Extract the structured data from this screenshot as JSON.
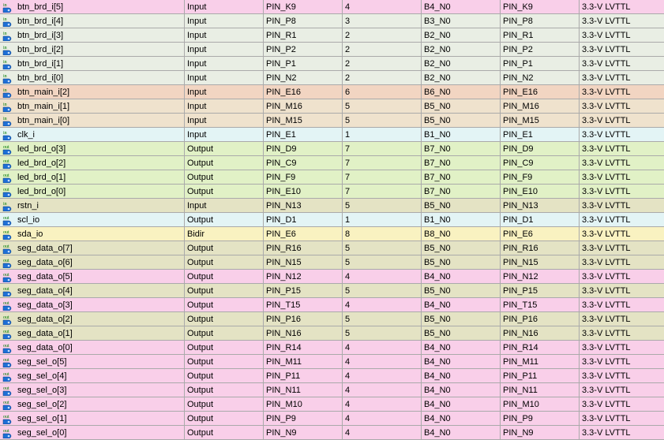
{
  "rows": [
    {
      "dir": "in",
      "bg": "pink",
      "name": "btn_brd_i[5]",
      "direction": "Input",
      "pin": "PIN_K9",
      "bank": "4",
      "vref": "B4_N0",
      "fit": "PIN_K9",
      "std": "3.3-V LVTTL"
    },
    {
      "dir": "in",
      "bg": "grey",
      "name": "btn_brd_i[4]",
      "direction": "Input",
      "pin": "PIN_P8",
      "bank": "3",
      "vref": "B3_N0",
      "fit": "PIN_P8",
      "std": "3.3-V LVTTL"
    },
    {
      "dir": "in",
      "bg": "grey",
      "name": "btn_brd_i[3]",
      "direction": "Input",
      "pin": "PIN_R1",
      "bank": "2",
      "vref": "B2_N0",
      "fit": "PIN_R1",
      "std": "3.3-V LVTTL"
    },
    {
      "dir": "in",
      "bg": "grey",
      "name": "btn_brd_i[2]",
      "direction": "Input",
      "pin": "PIN_P2",
      "bank": "2",
      "vref": "B2_N0",
      "fit": "PIN_P2",
      "std": "3.3-V LVTTL"
    },
    {
      "dir": "in",
      "bg": "grey",
      "name": "btn_brd_i[1]",
      "direction": "Input",
      "pin": "PIN_P1",
      "bank": "2",
      "vref": "B2_N0",
      "fit": "PIN_P1",
      "std": "3.3-V LVTTL"
    },
    {
      "dir": "in",
      "bg": "grey",
      "name": "btn_brd_i[0]",
      "direction": "Input",
      "pin": "PIN_N2",
      "bank": "2",
      "vref": "B2_N0",
      "fit": "PIN_N2",
      "std": "3.3-V LVTTL"
    },
    {
      "dir": "in",
      "bg": "peach",
      "name": "btn_main_i[2]",
      "direction": "Input",
      "pin": "PIN_E16",
      "bank": "6",
      "vref": "B6_N0",
      "fit": "PIN_E16",
      "std": "3.3-V LVTTL"
    },
    {
      "dir": "in",
      "bg": "tan",
      "name": "btn_main_i[1]",
      "direction": "Input",
      "pin": "PIN_M16",
      "bank": "5",
      "vref": "B5_N0",
      "fit": "PIN_M16",
      "std": "3.3-V LVTTL"
    },
    {
      "dir": "in",
      "bg": "tan",
      "name": "btn_main_i[0]",
      "direction": "Input",
      "pin": "PIN_M15",
      "bank": "5",
      "vref": "B5_N0",
      "fit": "PIN_M15",
      "std": "3.3-V LVTTL"
    },
    {
      "dir": "in",
      "bg": "cyan",
      "name": "clk_i",
      "direction": "Input",
      "pin": "PIN_E1",
      "bank": "1",
      "vref": "B1_N0",
      "fit": "PIN_E1",
      "std": "3.3-V LVTTL"
    },
    {
      "dir": "out",
      "bg": "green",
      "name": "led_brd_o[3]",
      "direction": "Output",
      "pin": "PIN_D9",
      "bank": "7",
      "vref": "B7_N0",
      "fit": "PIN_D9",
      "std": "3.3-V LVTTL"
    },
    {
      "dir": "out",
      "bg": "green",
      "name": "led_brd_o[2]",
      "direction": "Output",
      "pin": "PIN_C9",
      "bank": "7",
      "vref": "B7_N0",
      "fit": "PIN_C9",
      "std": "3.3-V LVTTL"
    },
    {
      "dir": "out",
      "bg": "green",
      "name": "led_brd_o[1]",
      "direction": "Output",
      "pin": "PIN_F9",
      "bank": "7",
      "vref": "B7_N0",
      "fit": "PIN_F9",
      "std": "3.3-V LVTTL"
    },
    {
      "dir": "out",
      "bg": "green",
      "name": "led_brd_o[0]",
      "direction": "Output",
      "pin": "PIN_E10",
      "bank": "7",
      "vref": "B7_N0",
      "fit": "PIN_E10",
      "std": "3.3-V LVTTL"
    },
    {
      "dir": "in",
      "bg": "olive",
      "name": "rstn_i",
      "direction": "Input",
      "pin": "PIN_N13",
      "bank": "5",
      "vref": "B5_N0",
      "fit": "PIN_N13",
      "std": "3.3-V LVTTL"
    },
    {
      "dir": "out",
      "bg": "cyan",
      "name": "scl_io",
      "direction": "Output",
      "pin": "PIN_D1",
      "bank": "1",
      "vref": "B1_N0",
      "fit": "PIN_D1",
      "std": "3.3-V LVTTL"
    },
    {
      "dir": "out",
      "bg": "yellow",
      "name": "sda_io",
      "direction": "Bidir",
      "pin": "PIN_E6",
      "bank": "8",
      "vref": "B8_N0",
      "fit": "PIN_E6",
      "std": "3.3-V LVTTL"
    },
    {
      "dir": "out",
      "bg": "olive",
      "name": "seg_data_o[7]",
      "direction": "Output",
      "pin": "PIN_R16",
      "bank": "5",
      "vref": "B5_N0",
      "fit": "PIN_R16",
      "std": "3.3-V LVTTL"
    },
    {
      "dir": "out",
      "bg": "olive",
      "name": "seg_data_o[6]",
      "direction": "Output",
      "pin": "PIN_N15",
      "bank": "5",
      "vref": "B5_N0",
      "fit": "PIN_N15",
      "std": "3.3-V LVTTL"
    },
    {
      "dir": "out",
      "bg": "pink",
      "name": "seg_data_o[5]",
      "direction": "Output",
      "pin": "PIN_N12",
      "bank": "4",
      "vref": "B4_N0",
      "fit": "PIN_N12",
      "std": "3.3-V LVTTL"
    },
    {
      "dir": "out",
      "bg": "olive",
      "name": "seg_data_o[4]",
      "direction": "Output",
      "pin": "PIN_P15",
      "bank": "5",
      "vref": "B5_N0",
      "fit": "PIN_P15",
      "std": "3.3-V LVTTL"
    },
    {
      "dir": "out",
      "bg": "pink",
      "name": "seg_data_o[3]",
      "direction": "Output",
      "pin": "PIN_T15",
      "bank": "4",
      "vref": "B4_N0",
      "fit": "PIN_T15",
      "std": "3.3-V LVTTL"
    },
    {
      "dir": "out",
      "bg": "olive",
      "name": "seg_data_o[2]",
      "direction": "Output",
      "pin": "PIN_P16",
      "bank": "5",
      "vref": "B5_N0",
      "fit": "PIN_P16",
      "std": "3.3-V LVTTL"
    },
    {
      "dir": "out",
      "bg": "olive",
      "name": "seg_data_o[1]",
      "direction": "Output",
      "pin": "PIN_N16",
      "bank": "5",
      "vref": "B5_N0",
      "fit": "PIN_N16",
      "std": "3.3-V LVTTL"
    },
    {
      "dir": "out",
      "bg": "pink",
      "name": "seg_data_o[0]",
      "direction": "Output",
      "pin": "PIN_R14",
      "bank": "4",
      "vref": "B4_N0",
      "fit": "PIN_R14",
      "std": "3.3-V LVTTL"
    },
    {
      "dir": "out",
      "bg": "pink",
      "name": "seg_sel_o[5]",
      "direction": "Output",
      "pin": "PIN_M11",
      "bank": "4",
      "vref": "B4_N0",
      "fit": "PIN_M11",
      "std": "3.3-V LVTTL"
    },
    {
      "dir": "out",
      "bg": "pink",
      "name": "seg_sel_o[4]",
      "direction": "Output",
      "pin": "PIN_P11",
      "bank": "4",
      "vref": "B4_N0",
      "fit": "PIN_P11",
      "std": "3.3-V LVTTL"
    },
    {
      "dir": "out",
      "bg": "pink",
      "name": "seg_sel_o[3]",
      "direction": "Output",
      "pin": "PIN_N11",
      "bank": "4",
      "vref": "B4_N0",
      "fit": "PIN_N11",
      "std": "3.3-V LVTTL"
    },
    {
      "dir": "out",
      "bg": "pink",
      "name": "seg_sel_o[2]",
      "direction": "Output",
      "pin": "PIN_M10",
      "bank": "4",
      "vref": "B4_N0",
      "fit": "PIN_M10",
      "std": "3.3-V LVTTL"
    },
    {
      "dir": "out",
      "bg": "pink",
      "name": "seg_sel_o[1]",
      "direction": "Output",
      "pin": "PIN_P9",
      "bank": "4",
      "vref": "B4_N0",
      "fit": "PIN_P9",
      "std": "3.3-V LVTTL"
    },
    {
      "dir": "out",
      "bg": "pink",
      "name": "seg_sel_o[0]",
      "direction": "Output",
      "pin": "PIN_N9",
      "bank": "4",
      "vref": "B4_N0",
      "fit": "PIN_N9",
      "std": "3.3-V LVTTL"
    }
  ]
}
